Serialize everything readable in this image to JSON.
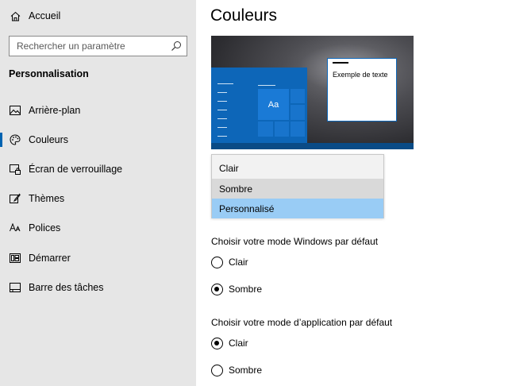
{
  "sidebar": {
    "home_label": "Accueil",
    "search_placeholder": "Rechercher un paramètre",
    "section_title": "Personnalisation",
    "items": [
      {
        "label": "Arrière-plan",
        "icon": "picture-icon",
        "active": false
      },
      {
        "label": "Couleurs",
        "icon": "palette-icon",
        "active": true
      },
      {
        "label": "Écran de verrouillage",
        "icon": "lock-screen-icon",
        "active": false
      },
      {
        "label": "Thèmes",
        "icon": "brush-icon",
        "active": false
      },
      {
        "label": "Polices",
        "icon": "font-icon",
        "active": false
      },
      {
        "label": "Démarrer",
        "icon": "start-icon",
        "active": false
      },
      {
        "label": "Barre des tâches",
        "icon": "taskbar-icon",
        "active": false
      }
    ]
  },
  "main": {
    "title": "Couleurs",
    "preview": {
      "tile_text": "Aa",
      "sample_text": "Exemple de texte"
    },
    "dropdown": {
      "options": [
        "Clair",
        "Sombre",
        "Personnalisé"
      ],
      "hovered": "Sombre",
      "selected": "Personnalisé"
    },
    "windows_mode": {
      "label": "Choisir votre mode Windows par défaut",
      "options": [
        "Clair",
        "Sombre"
      ],
      "selected": "Sombre"
    },
    "app_mode": {
      "label": "Choisir votre mode d’application par défaut",
      "options": [
        "Clair",
        "Sombre"
      ],
      "selected": "Clair"
    }
  },
  "colors": {
    "accent": "#0063b1",
    "sidebar_bg": "#e6e6e6",
    "selected_option_bg": "#99ccf5"
  }
}
